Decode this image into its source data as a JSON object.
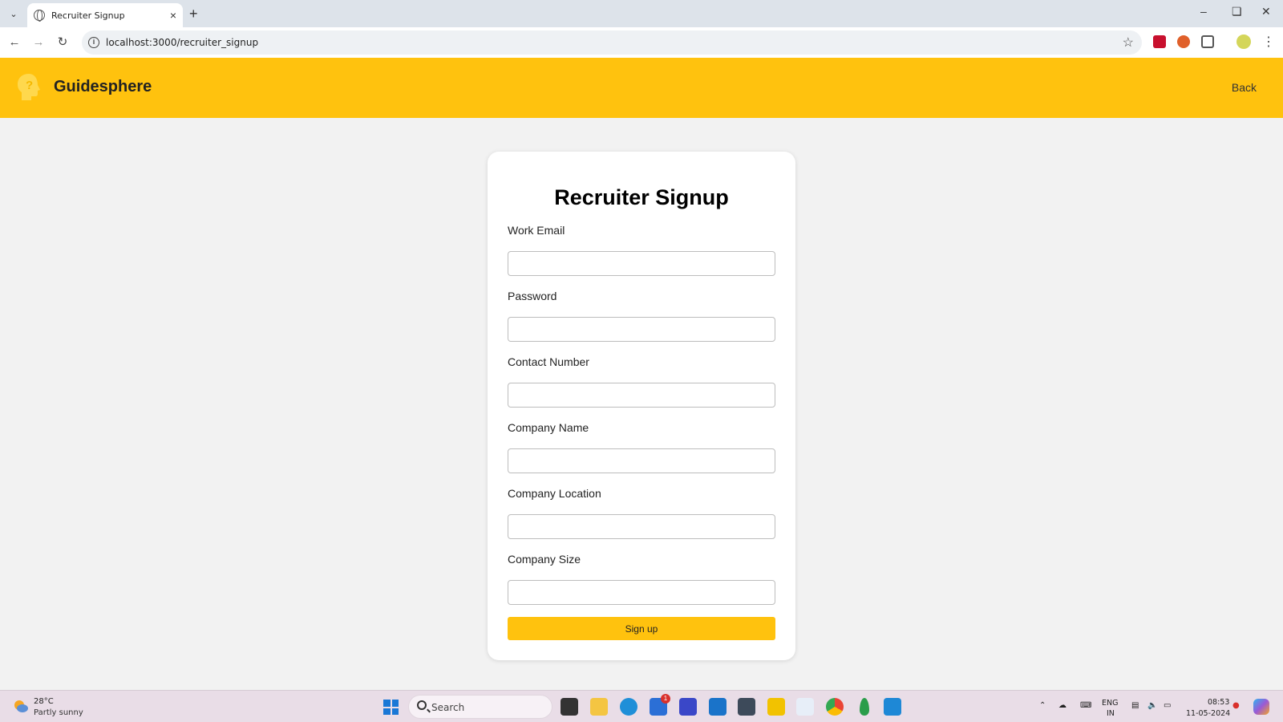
{
  "browser": {
    "tab_title": "Recruiter Signup",
    "url": "localhost:3000/recruiter_signup"
  },
  "header": {
    "brand": "Guidesphere",
    "back_label": "Back",
    "accent_color": "#ffc20e"
  },
  "form": {
    "title": "Recruiter Signup",
    "fields": [
      {
        "label": "Work Email",
        "value": ""
      },
      {
        "label": "Password",
        "value": ""
      },
      {
        "label": "Contact Number",
        "value": ""
      },
      {
        "label": "Company Name",
        "value": ""
      },
      {
        "label": "Company Location",
        "value": ""
      },
      {
        "label": "Company Size",
        "value": ""
      }
    ],
    "submit_label": "Sign up"
  },
  "taskbar": {
    "weather_temp": "28°C",
    "weather_desc": "Partly sunny",
    "search_label": "Search",
    "lang_top": "ENG",
    "lang_bottom": "IN",
    "time": "08:53",
    "date": "11-05-2024",
    "store_badge": "1"
  }
}
